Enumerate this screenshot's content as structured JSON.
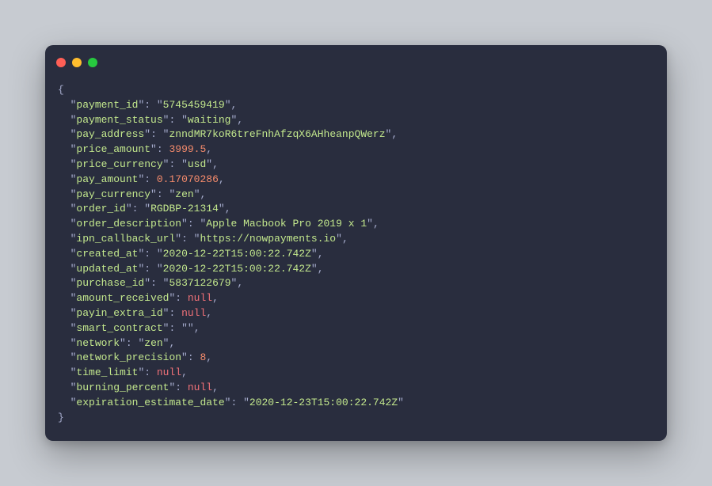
{
  "code_payload": {
    "payment_id": "5745459419",
    "payment_status": "waiting",
    "pay_address": "znndMR7koR6treFnhAfzqX6AHheanpQWerz",
    "price_amount": 3999.5,
    "price_currency": "usd",
    "pay_amount": 0.17070286,
    "pay_currency": "zen",
    "order_id": "RGDBP-21314",
    "order_description": "Apple Macbook Pro 2019 x 1",
    "ipn_callback_url": "https://nowpayments.io",
    "created_at": "2020-12-22T15:00:22.742Z",
    "updated_at": "2020-12-22T15:00:22.742Z",
    "purchase_id": "5837122679",
    "amount_received": null,
    "payin_extra_id": null,
    "smart_contract": "",
    "network": "zen",
    "network_precision": 8,
    "time_limit": null,
    "burning_percent": null,
    "expiration_estimate_date": "2020-12-23T15:00:22.742Z"
  },
  "key_order": [
    "payment_id",
    "payment_status",
    "pay_address",
    "price_amount",
    "price_currency",
    "pay_amount",
    "pay_currency",
    "order_id",
    "order_description",
    "ipn_callback_url",
    "created_at",
    "updated_at",
    "purchase_id",
    "amount_received",
    "payin_extra_id",
    "smart_contract",
    "network",
    "network_precision",
    "time_limit",
    "burning_percent",
    "expiration_estimate_date"
  ]
}
